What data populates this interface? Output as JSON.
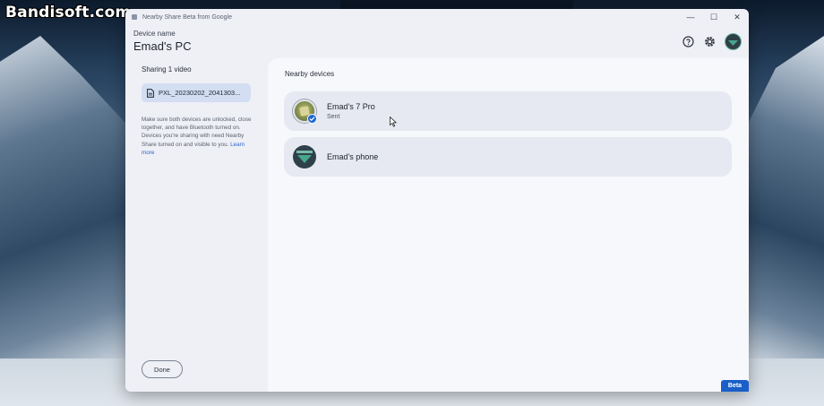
{
  "watermark": "Bandisoft.com",
  "window": {
    "title": "Nearby Share Beta from Google",
    "controls": {
      "minimize": "—",
      "maximize": "☐",
      "close": "✕"
    }
  },
  "header": {
    "device_label": "Device name",
    "device_name": "Emad's PC",
    "icons": [
      "help-icon",
      "settings-icon",
      "profile-avatar"
    ]
  },
  "sidebar": {
    "sharing_title": "Sharing 1 video",
    "file_name": "PXL_20230202_2041303...",
    "hint": "Make sure both devices are unlocked, close together, and have Bluetooth turned on. Devices you're sharing with need Nearby Share turned on and visible to you.",
    "learn_more": "Learn more",
    "done_label": "Done"
  },
  "main": {
    "section_title": "Nearby devices",
    "devices": [
      {
        "name": "Emad's 7 Pro",
        "status": "Sent"
      },
      {
        "name": "Emad's phone",
        "status": ""
      }
    ]
  },
  "badge": "Beta",
  "colors": {
    "accent": "#1a5fc8",
    "file_chip": "#d3def3",
    "card": "#e6e9f1",
    "panel": "#f7f8fc"
  }
}
